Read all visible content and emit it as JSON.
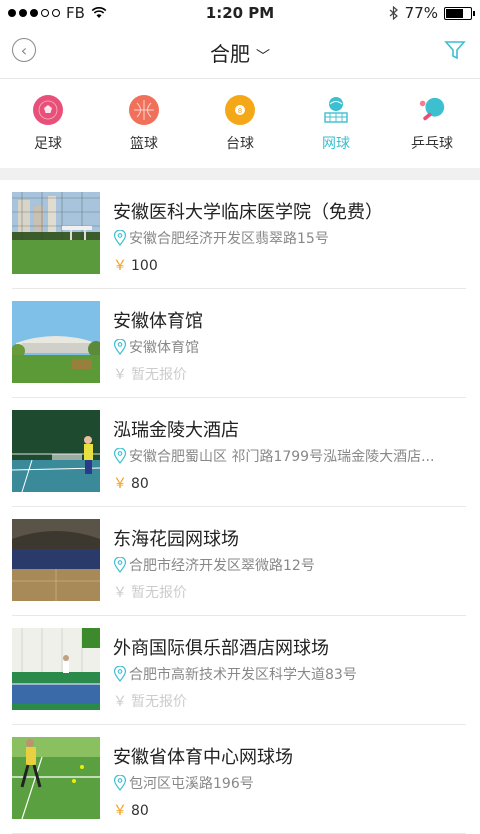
{
  "status": {
    "carrier": "FB",
    "time": "1:20 PM",
    "battery": "77%",
    "battery_level": 0.77
  },
  "nav": {
    "city": "合肥",
    "chevron": "﹀",
    "back_icon": "back-circle-icon",
    "filter_icon": "filter-icon"
  },
  "categories": [
    {
      "label": "足球",
      "icon": "soccer-icon",
      "color": "#e8507a"
    },
    {
      "label": "篮球",
      "icon": "basketball-icon",
      "color": "#f0705a"
    },
    {
      "label": "台球",
      "icon": "billiards-icon",
      "color": "#f4a818"
    },
    {
      "label": "网球",
      "icon": "tennis-icon",
      "color": "#3cbfcf",
      "active": true
    },
    {
      "label": "乒乓球",
      "icon": "ping-pong-icon",
      "color": "#3cbfcf"
    }
  ],
  "venues": [
    {
      "name": "安徽医科大学临床医学院（免费）",
      "address": "安徽合肥经济开发区翡翠路15号",
      "price": "100",
      "currency": "￥"
    },
    {
      "name": "安徽体育馆",
      "address": "安徽体育馆",
      "price": "暂无报价",
      "currency": "￥"
    },
    {
      "name": "泓瑞金陵大酒店",
      "address": "安徽合肥蜀山区 祁门路1799号泓瑞金陵大酒店...",
      "price": "80",
      "currency": "￥"
    },
    {
      "name": "东海花园网球场",
      "address": "合肥市经济开发区翠微路12号",
      "price": "暂无报价",
      "currency": "￥"
    },
    {
      "name": "外商国际俱乐部酒店网球场",
      "address": "合肥市高新技术开发区科学大道83号",
      "price": "暂无报价",
      "currency": "￥"
    },
    {
      "name": "安徽省体育中心网球场",
      "address": "包河区屯溪路196号",
      "price": "80",
      "currency": "￥"
    }
  ],
  "colors": {
    "accent": "#3cbfcf",
    "price": "#f0a020"
  }
}
